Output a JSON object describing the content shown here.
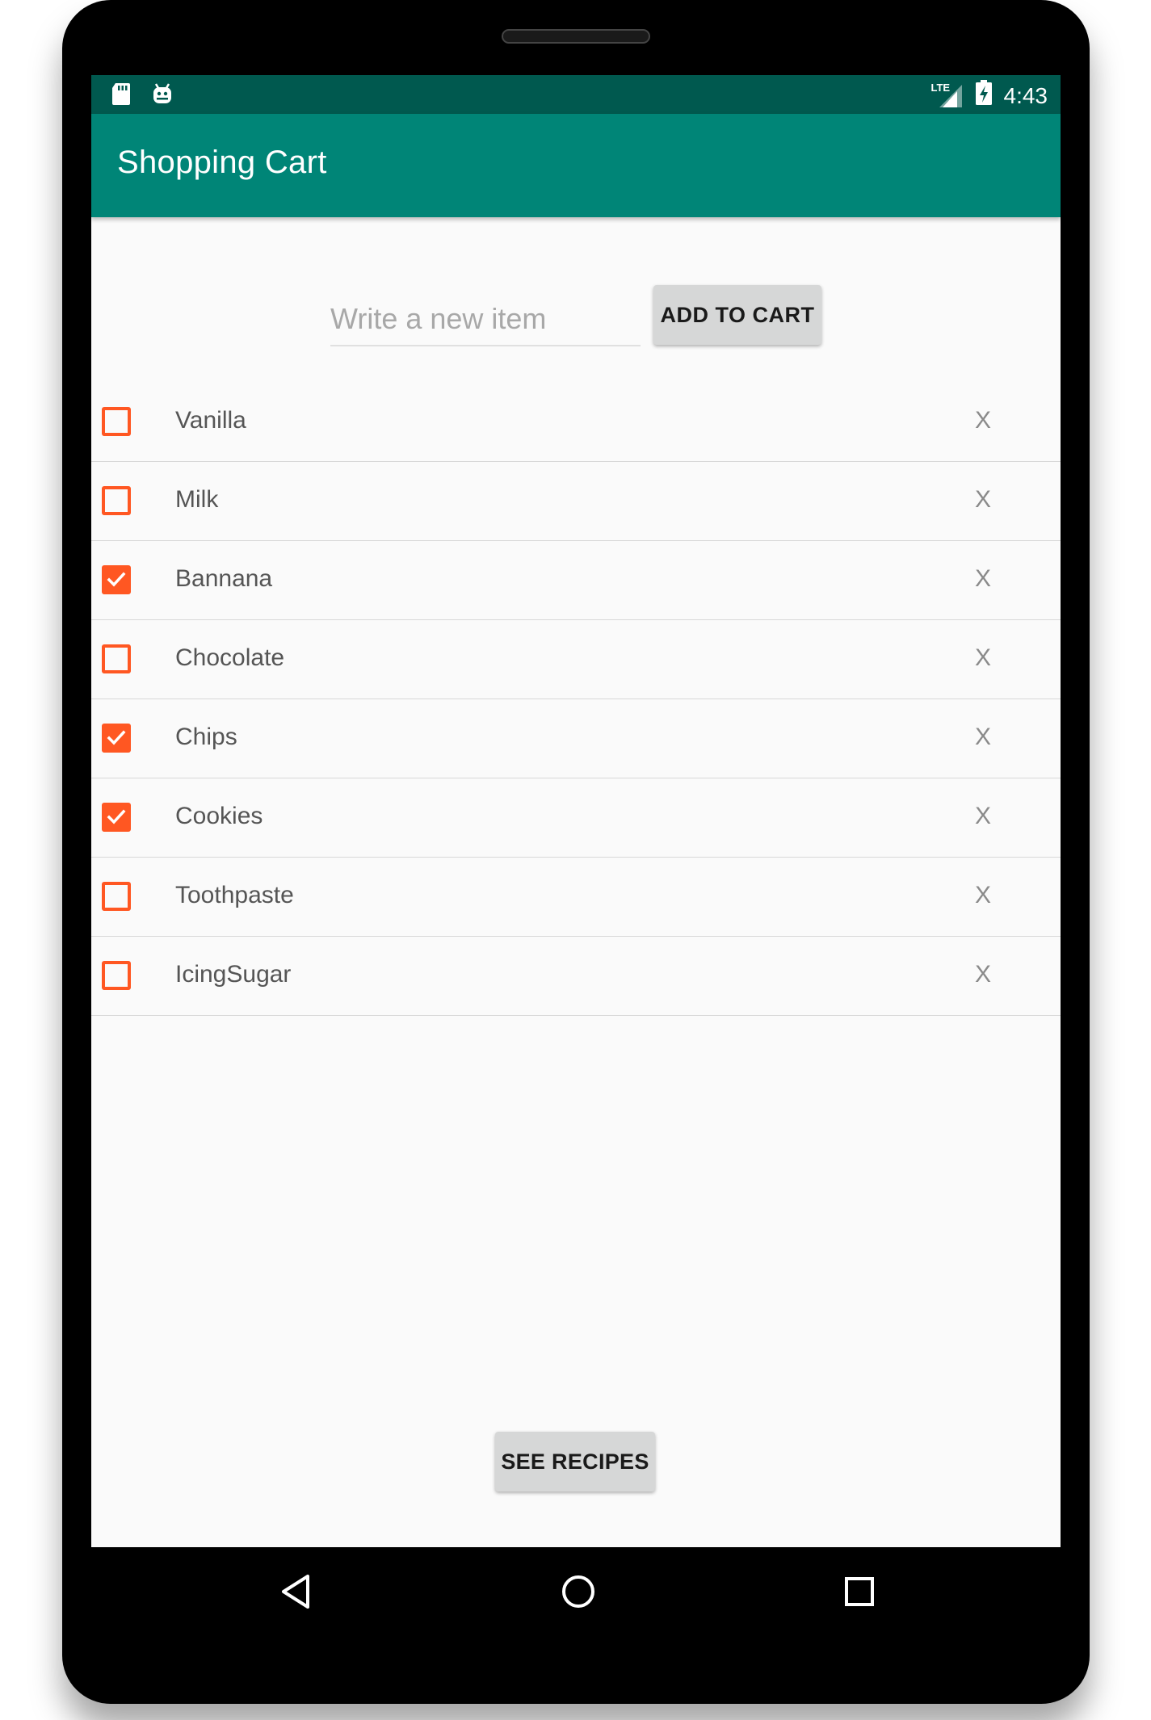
{
  "status_bar": {
    "time": "4:43",
    "network_label": "LTE",
    "icons": [
      "sd-card-icon",
      "android-icon",
      "signal-icon",
      "battery-icon"
    ]
  },
  "toolbar": {
    "title": "Shopping Cart"
  },
  "new_item": {
    "placeholder": "Write a new item",
    "value": "",
    "add_button_label": "ADD TO CART"
  },
  "items": [
    {
      "label": "Vanilla",
      "checked": false,
      "delete_label": "X"
    },
    {
      "label": "Milk",
      "checked": false,
      "delete_label": "X"
    },
    {
      "label": "Bannana",
      "checked": true,
      "delete_label": "X"
    },
    {
      "label": "Chocolate",
      "checked": false,
      "delete_label": "X"
    },
    {
      "label": "Chips",
      "checked": true,
      "delete_label": "X"
    },
    {
      "label": "Cookies",
      "checked": true,
      "delete_label": "X"
    },
    {
      "label": "Toothpaste",
      "checked": false,
      "delete_label": "X"
    },
    {
      "label": "IcingSugar",
      "checked": false,
      "delete_label": "X"
    }
  ],
  "footer": {
    "recipes_button_label": "SEE RECIPES"
  },
  "nav": [
    "back-icon",
    "home-icon",
    "recents-icon"
  ],
  "colors": {
    "status_bar": "#00594f",
    "toolbar": "#008577",
    "checkbox_accent": "#ff5722",
    "background": "#fafafa"
  }
}
